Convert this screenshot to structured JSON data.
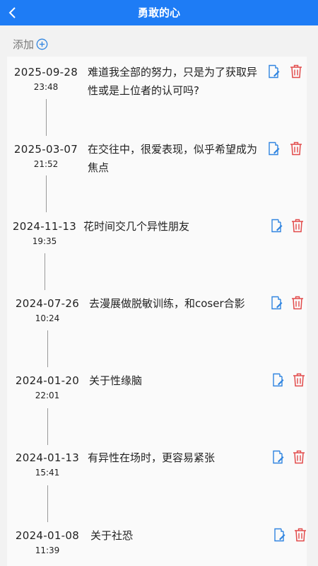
{
  "header": {
    "title": "勇敢的心",
    "back_icon": "chevron-left-icon"
  },
  "toolbar": {
    "add_label": "添加",
    "add_icon": "plus-circle-icon"
  },
  "colors": {
    "header": "#1e7cf5",
    "edit_icon": "#2f84e0",
    "delete_icon": "#e24a4a"
  },
  "entries": [
    {
      "date": "2025-09-28",
      "time": "23:48",
      "text": [
        "难道我全部的努力，只是为了获取异",
        "性或是上位者的认可吗?"
      ]
    },
    {
      "date": "2025-03-07",
      "time": "21:52",
      "text": [
        "在交往中，很爱表现，似乎希望成为",
        "焦点"
      ]
    },
    {
      "date": "2024-11-13",
      "time": "19:35",
      "text": [
        "花时间交几个异性朋友"
      ]
    },
    {
      "date": "2024-07-26",
      "time": "10:24",
      "text": [
        "去漫展做脱敏训练，和coser合影"
      ]
    },
    {
      "date": "2024-01-20",
      "time": "22:01",
      "text": [
        "关于性缘脑"
      ]
    },
    {
      "date": "2024-01-13",
      "time": "15:41",
      "text": [
        "有异性在场时，更容易紧张"
      ]
    },
    {
      "date": "2024-01-08",
      "time": "11:39",
      "text": [
        "关于社恐"
      ]
    }
  ]
}
